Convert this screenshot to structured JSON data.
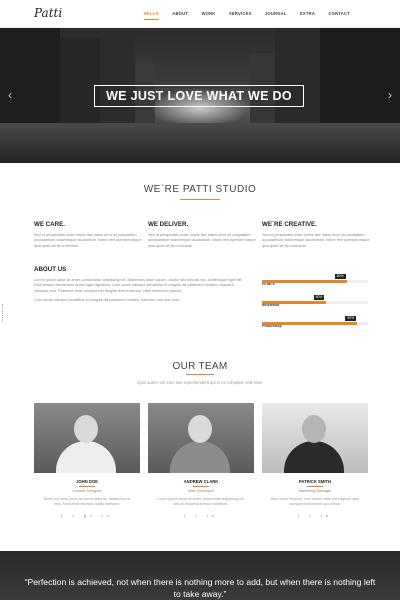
{
  "header": {
    "logo": "Patti",
    "nav": [
      "HELLO",
      "ABOUT",
      "WORK",
      "SERVICES",
      "JOURNAL",
      "EXTRA",
      "CONTACT"
    ],
    "active": "HELLO",
    "accent": "#e4862a"
  },
  "hero": {
    "title": "WE JUST LOVE WHAT WE DO",
    "prev_icon": "chevron-left-icon",
    "next_icon": "chevron-right-icon"
  },
  "studio": {
    "title": "WE`RE PATTI STUDIO",
    "columns": [
      {
        "heading": "WE CARE.",
        "text": "Sed ut perspiciatis unde omnis iste natus error sit voluptatem accusantium doloremque laudantium, totam rem aperiam eaque ipsa quae ab illo inventore."
      },
      {
        "heading": "WE DELIVER.",
        "text": "Sed ut perspiciatis unde omnis iste natus error sit voluptatem accusantium doloremque laudantium, totam rem aperiam eaque ipsa quae ab illo inventore."
      },
      {
        "heading": "WE`RE CREATIVE.",
        "text": "Sed ut perspiciatis unde omnis iste natus error sit voluptatem accusantium doloremque laudantium, totam rem aperiam eaque ipsa quae ab illo inventore."
      }
    ],
    "about": {
      "heading": "ABOUT US",
      "paragraph1": "Lorem ipsum dolor sit amet, consectetur adipiscing elit. Maecenas diam sapien, auctor sed blandit nec, scelerisque eget elit. Duis tempor elementum quam eget dignissim. Cum sociis natoque penatibus et magnis dis parturient montes, nascetur ridiculus mus. Praesent vitae volutpat nisi fringilla ferm euismod, vitae bibendum mauris.",
      "paragraph2": "Cum sociis natoque penatibus et magnis dis parturient montes, nascetur ridiculus mus..."
    },
    "skills": [
      {
        "label": "HTML5",
        "pct_label": "80%",
        "value": 0.8
      },
      {
        "label": "Illustrator",
        "pct_label": "60%",
        "value": 0.6
      },
      {
        "label": "Photoshop",
        "pct_label": "90%",
        "value": 0.9
      }
    ]
  },
  "team": {
    "title": "OUR TEAM",
    "subtitle": "Quis autem vel eum iure reprehenderit qui in ea voluptate velit esse",
    "members": [
      {
        "name": "JOHN DOE",
        "role": "Graphic Designer",
        "desc": "Morbi leo risus, porta ac consectetur ac, vestibulum at eros. Maecenas faucibus mollis interdum.",
        "social": "f ✓ g+ in"
      },
      {
        "name": "ANDREW CLARK",
        "role": "Web Developer",
        "desc": "Lorem ipsum dolor sit amet, consectetur adipiscing elit, sed do eiusmod tempor incididunt.",
        "social": "f ✓ in"
      },
      {
        "name": "PATRICK SMITH",
        "role": "Marketing Manager",
        "desc": "Nam libero tempore, cum soluta nobis est eligendi optio cumque nihil impedit quo minus.",
        "social": "f ✓ in"
      }
    ]
  },
  "quote": {
    "text": "“Perfection is achieved, not when there is nothing more to add, but when there is nothing left to take away.”"
  }
}
